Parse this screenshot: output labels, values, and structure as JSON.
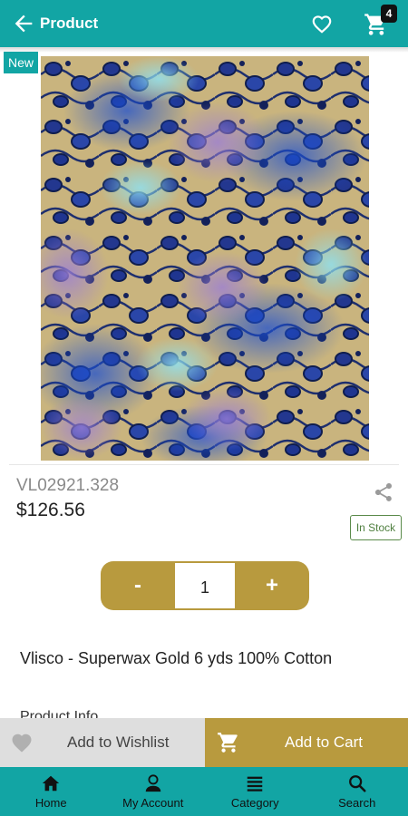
{
  "header": {
    "title": "Product",
    "cart_count": "4"
  },
  "product": {
    "badge": "New",
    "sku": "VL02921.328",
    "price": "$126.56",
    "stock_status": "In Stock",
    "name": "Vlisco - Superwax Gold 6 yds 100% Cotton",
    "quantity": "1",
    "info_heading": "Product Info"
  },
  "quantity_controls": {
    "minus": "-",
    "plus": "+"
  },
  "actions": {
    "wishlist": "Add to Wishlist",
    "add_to_cart": "Add to Cart"
  },
  "bottom_nav": [
    {
      "label": "Home",
      "icon": "home-icon"
    },
    {
      "label": "My Account",
      "icon": "account-icon"
    },
    {
      "label": "Category",
      "icon": "list-icon"
    },
    {
      "label": "Search",
      "icon": "search-icon"
    }
  ],
  "colors": {
    "primary": "#12a5a4",
    "accent": "#b89a3e",
    "stock": "#4f7f3f"
  }
}
